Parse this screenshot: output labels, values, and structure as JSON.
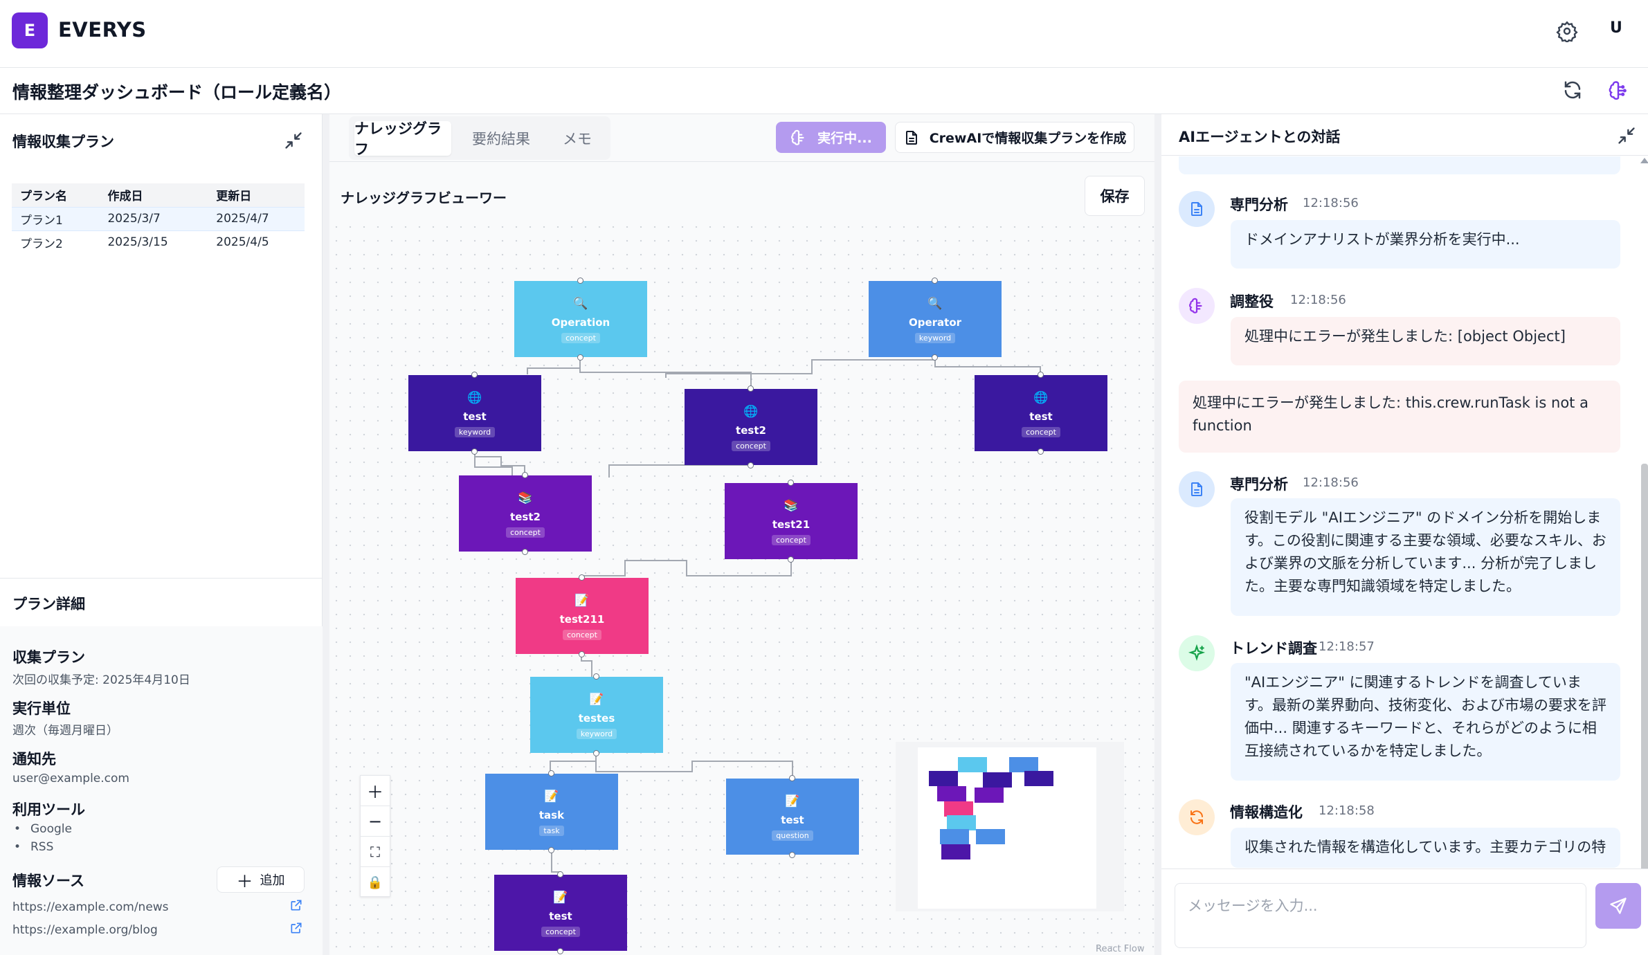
{
  "app": {
    "logo_letter": "E",
    "name": "EVERYS",
    "user_initial": "U"
  },
  "page": {
    "title": "情報整理ダッシュボード（ロール定義名）"
  },
  "plans": {
    "title": "情報収集プラン",
    "columns": [
      "プラン名",
      "作成日",
      "更新日"
    ],
    "rows": [
      [
        "プラン1",
        "2025/3/7",
        "2025/4/7"
      ],
      [
        "プラン2",
        "2025/3/15",
        "2025/4/5"
      ]
    ]
  },
  "detail": {
    "title": "プラン詳細",
    "collect_label": "収集プラン",
    "collect_value": "次回の収集予定: 2025年4月10日",
    "unit_label": "実行単位",
    "unit_value": "週次（毎週月曜日）",
    "notify_label": "通知先",
    "notify_value": "user@example.com",
    "tools_label": "利用ツール",
    "tools": [
      "Google",
      "RSS"
    ],
    "sources_label": "情報ソース",
    "add_label": "追加",
    "sources": [
      "https://example.com/news",
      "https://example.org/blog"
    ]
  },
  "center": {
    "tabs": [
      "ナレッジグラフ",
      "要約結果",
      "メモ"
    ],
    "running_label": "実行中...",
    "crewai_label": "CrewAIで情報収集プランを作成",
    "viewer_title": "ナレッジグラフビューワー",
    "save_label": "保存",
    "attribution": "React Flow"
  },
  "graph": {
    "nodes": [
      {
        "label": "Operation",
        "tag": "concept",
        "icon": "🔍"
      },
      {
        "label": "Operator",
        "tag": "keyword",
        "icon": "🔍"
      },
      {
        "label": "test",
        "tag": "keyword",
        "icon": "🌐"
      },
      {
        "label": "test2",
        "tag": "concept",
        "icon": "🌐"
      },
      {
        "label": "test",
        "tag": "concept",
        "icon": "🌐"
      },
      {
        "label": "test2",
        "tag": "concept",
        "icon": "📚"
      },
      {
        "label": "test21",
        "tag": "concept",
        "icon": "📚"
      },
      {
        "label": "test211",
        "tag": "concept",
        "icon": "📝"
      },
      {
        "label": "testes",
        "tag": "keyword",
        "icon": "📝"
      },
      {
        "label": "task",
        "tag": "task",
        "icon": "📝"
      },
      {
        "label": "test",
        "tag": "question",
        "icon": "📝"
      },
      {
        "label": "test",
        "tag": "concept",
        "icon": "📝"
      }
    ],
    "colors": {
      "concept_light": "#5bc8ee",
      "keyword_blue": "#4c8fe6",
      "deep_indigo": "#3a189f",
      "purple": "#6c17b8",
      "pink": "#f03a86"
    }
  },
  "chat": {
    "title": "AIエージェントとの対話",
    "messages": [
      {
        "name": "専門分析",
        "time": "12:18:56",
        "text": "ドメインアナリストが業界分析を実行中..."
      },
      {
        "name": "調整役",
        "time": "12:18:56",
        "text": "処理中にエラーが発生しました: [object Object]"
      },
      {
        "name": "",
        "time": "",
        "text": "処理中にエラーが発生しました: this.crew.runTask is not a function"
      },
      {
        "name": "専門分析",
        "time": "12:18:56",
        "text": "役割モデル \"AIエンジニア\" のドメイン分析を開始します。この役割に関連する主要な領域、必要なスキル、および業界の文脈を分析しています... 分析が完了しました。主要な専門知識領域を特定しました。"
      },
      {
        "name": "トレンド調査",
        "time": "12:18:57",
        "text": "\"AIエンジニア\" に関連するトレンドを調査しています。最新の業界動向、技術変化、および市場の要求を評価中... 関連するキーワードと、それらがどのように相互接続されているかを特定しました。"
      },
      {
        "name": "情報構造化",
        "time": "12:18:58",
        "text": "収集された情報を構造化しています。主要カテゴリの特"
      }
    ],
    "input_placeholder": "メッセージを入力..."
  }
}
